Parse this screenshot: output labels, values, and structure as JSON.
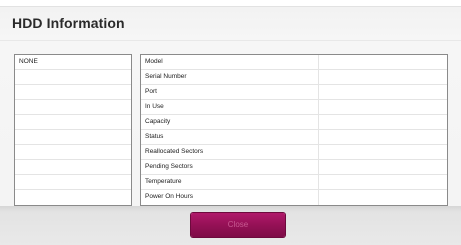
{
  "dialog": {
    "title": "HDD Information",
    "close_label": "Close"
  },
  "device_list": {
    "items": [
      "NONE",
      "",
      "",
      "",
      "",
      "",
      "",
      "",
      "",
      ""
    ]
  },
  "info_table": {
    "rows": [
      {
        "label": "Model",
        "value": ""
      },
      {
        "label": "Serial Number",
        "value": ""
      },
      {
        "label": "Port",
        "value": ""
      },
      {
        "label": "In Use",
        "value": ""
      },
      {
        "label": "Capacity",
        "value": ""
      },
      {
        "label": "Status",
        "value": ""
      },
      {
        "label": "Reallocated Sectors",
        "value": ""
      },
      {
        "label": "Pending Sectors",
        "value": ""
      },
      {
        "label": "Temperature",
        "value": ""
      },
      {
        "label": "Power On Hours",
        "value": ""
      }
    ]
  },
  "colors": {
    "accent": "#951156",
    "button_text": "#c85a92",
    "border": "#8a8a8a"
  }
}
